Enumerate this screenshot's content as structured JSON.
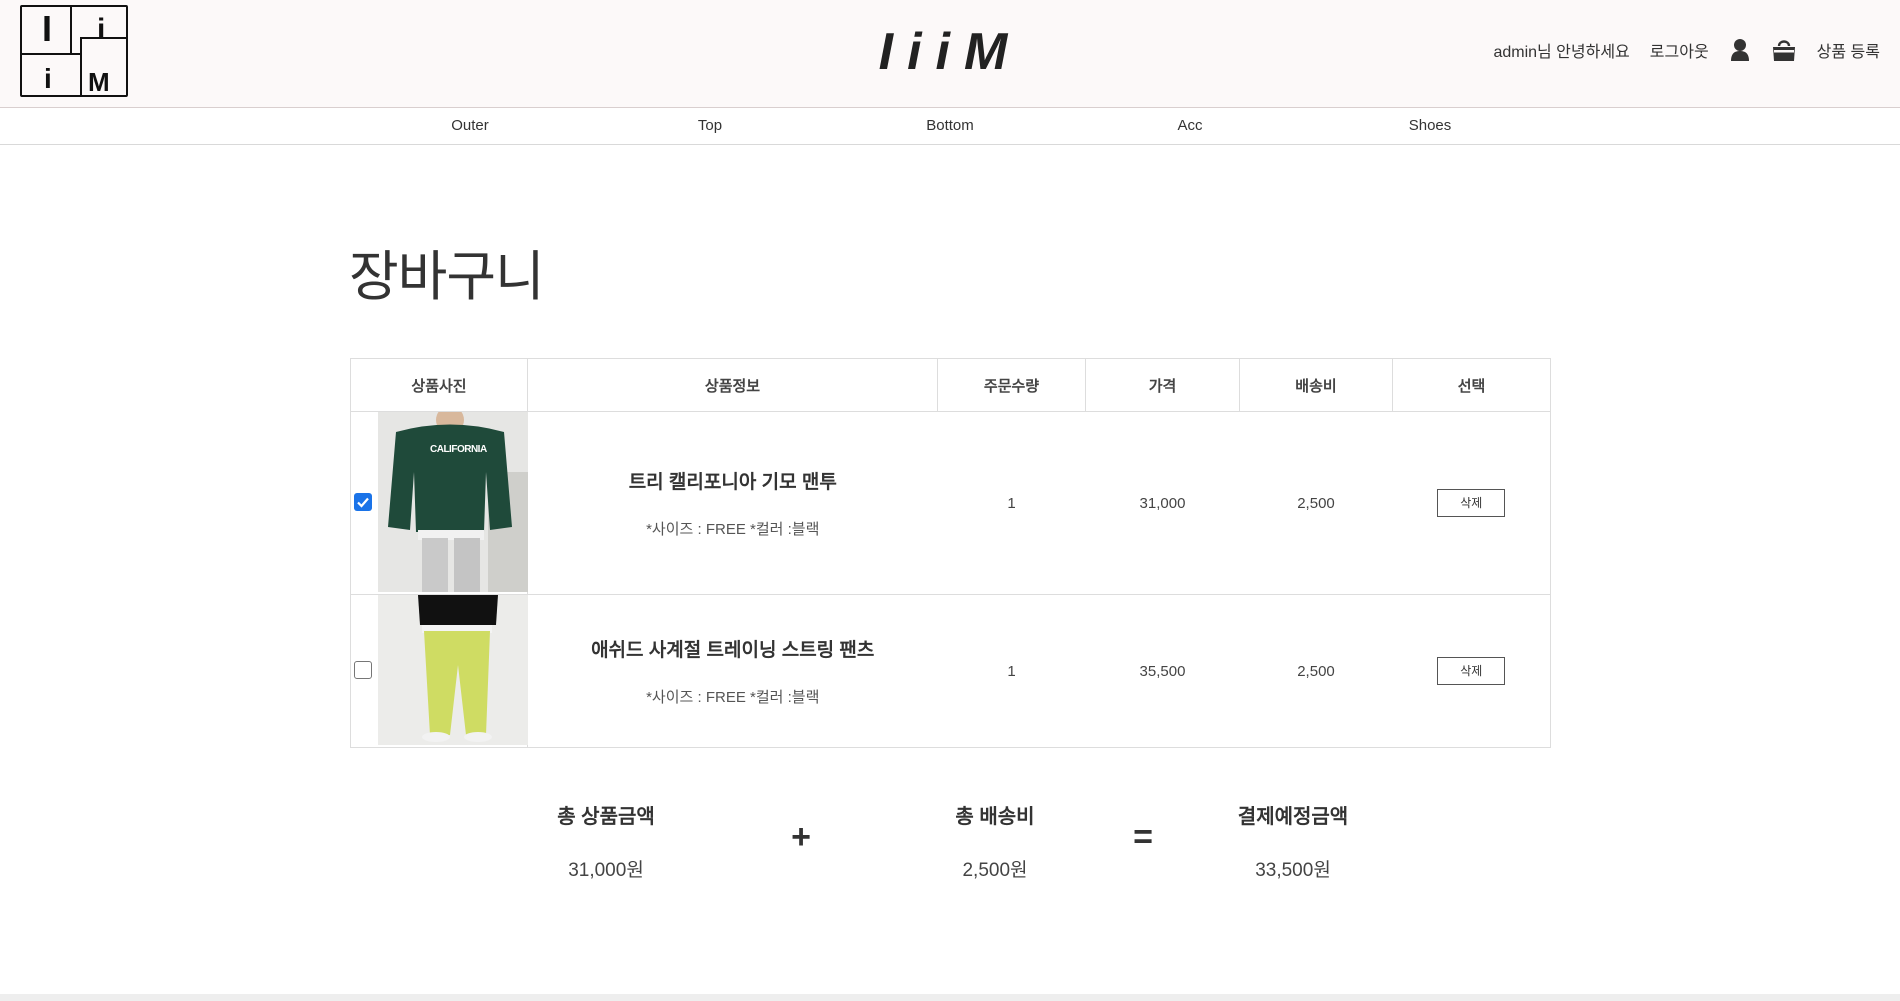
{
  "header": {
    "logo_letters": [
      "I",
      "i",
      "i",
      "M"
    ],
    "brand": "IiiM",
    "greeting": "admin님 안녕하세요",
    "logout": "로그아웃",
    "user_icon": "user-icon",
    "cart_icon": "shopping-bag-icon",
    "register": "상품 등록"
  },
  "nav": {
    "items": [
      "Outer",
      "Top",
      "Bottom",
      "Acc",
      "Shoes"
    ]
  },
  "page": {
    "title": "장바구니"
  },
  "cart": {
    "headers": [
      "상품사진",
      "상품정보",
      "주문수량",
      "가격",
      "배송비",
      "선택"
    ],
    "items": [
      {
        "checked": true,
        "name": "트리 캘리포니아 기모 맨투",
        "option": "*사이즈 : FREE *컬러 :블랙",
        "qty": "1",
        "price": "31,000",
        "shipping": "2,500",
        "action": "삭제",
        "image_text": "CALIFORNIA",
        "image_colors": {
          "top": "#1f4a3a",
          "bottom": "#c9c9c9",
          "bg": "#e6e6e4"
        }
      },
      {
        "checked": false,
        "name": "애쉬드 사계절 트레이닝 스트링 팬츠",
        "option": "*사이즈 : FREE *컬러 :블랙",
        "qty": "1",
        "price": "35,500",
        "shipping": "2,500",
        "action": "삭제",
        "image_colors": {
          "top": "#111111",
          "bottom": "#cfdc63",
          "bg": "#ececea"
        }
      }
    ]
  },
  "summary": {
    "total_products_label": "총 상품금액",
    "total_products_value": "31,000원",
    "plus": "+",
    "total_shipping_label": "총 배송비",
    "total_shipping_value": "2,500원",
    "equals": "=",
    "payment_label": "결제예정금액",
    "payment_value": "33,500원"
  }
}
